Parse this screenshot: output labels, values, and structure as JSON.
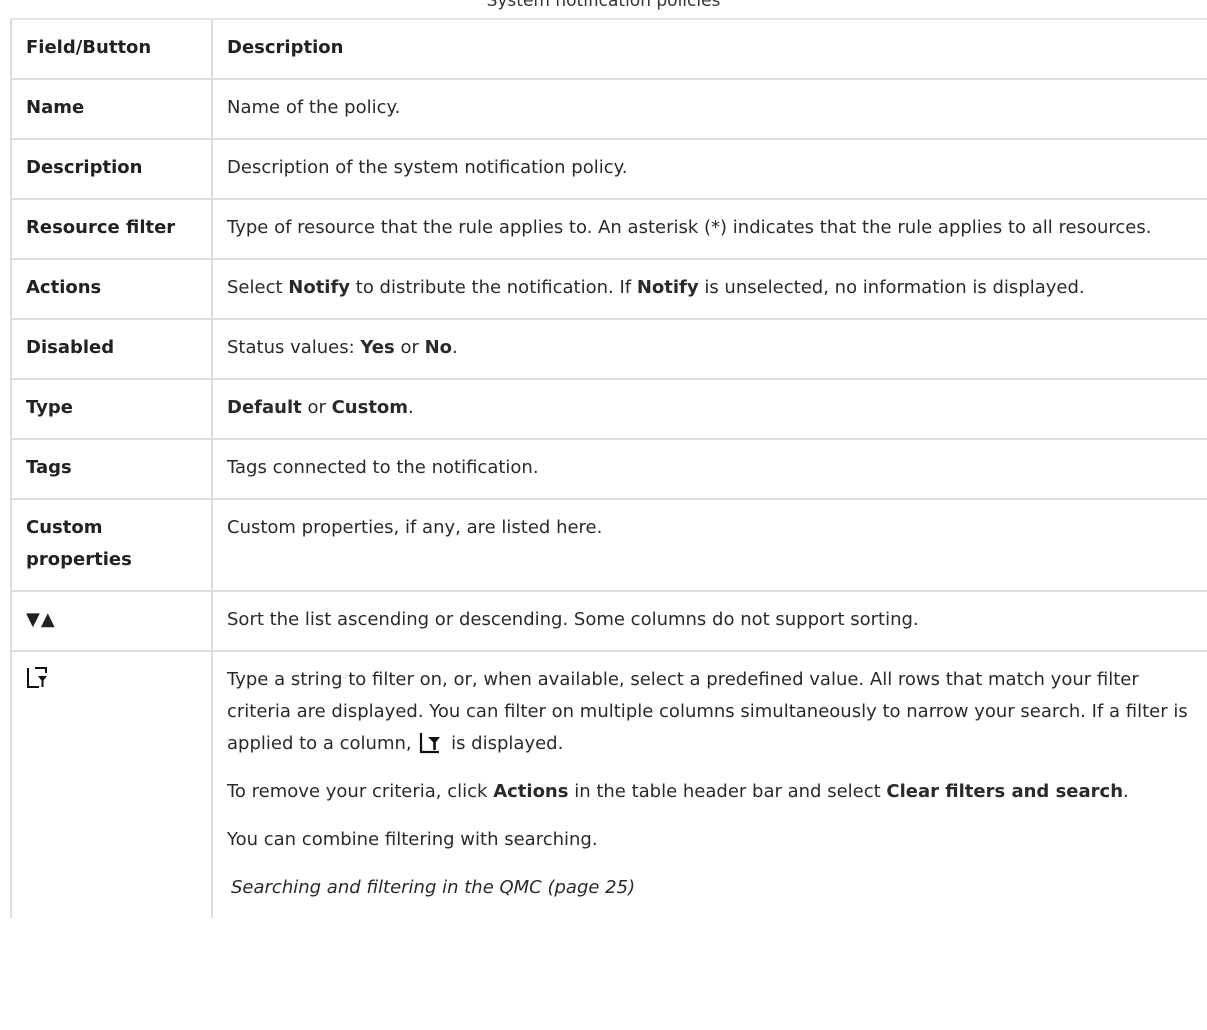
{
  "caption": "System notification policies",
  "table": {
    "headers": [
      "Field/Button",
      "Description"
    ],
    "rows": [
      {
        "field": "Name",
        "desc": [
          "Name of the policy."
        ]
      },
      {
        "field": "Description",
        "desc": [
          "Description of the system notification policy."
        ]
      },
      {
        "field": "Resource filter",
        "desc": [
          "Type of resource that the rule applies to. An asterisk (*) indicates that the rule applies to all resources."
        ]
      },
      {
        "field": "Actions",
        "desc": [
          "Select ",
          "Notify",
          " to distribute the notification. If ",
          "Notify",
          " is unselected, no information is displayed."
        ]
      },
      {
        "field": "Disabled",
        "desc": [
          "Status values: ",
          "Yes",
          " or ",
          "No",
          "."
        ]
      },
      {
        "field": "Type",
        "desc": [
          "Default",
          " or ",
          "Custom",
          "."
        ]
      },
      {
        "field": "Tags",
        "desc": [
          "Tags connected to the notification."
        ]
      },
      {
        "field": "Custom properties",
        "desc": [
          "Custom properties, if any, are listed here."
        ]
      },
      {
        "field_icon": "sort-arrows-icon",
        "field_glyph": "▼▲",
        "desc": [
          "Sort the list ascending or descending. Some columns do not support sorting."
        ]
      },
      {
        "field_icon": "filter-icon",
        "paragraphs": [
          [
            "Type a string to filter on, or, when available, select a predefined value. All rows that match your filter criteria are displayed. You can filter on multiple columns simultaneously to narrow your search. If a filter is applied to a column, ",
            " is displayed."
          ],
          [
            "To remove your criteria, click ",
            "Actions",
            " in the table header bar and select ",
            "Clear filters and search",
            "."
          ],
          [
            "You can combine filtering with searching."
          ],
          [
            "Searching and filtering in the QMC (page 25)"
          ]
        ]
      }
    ]
  }
}
